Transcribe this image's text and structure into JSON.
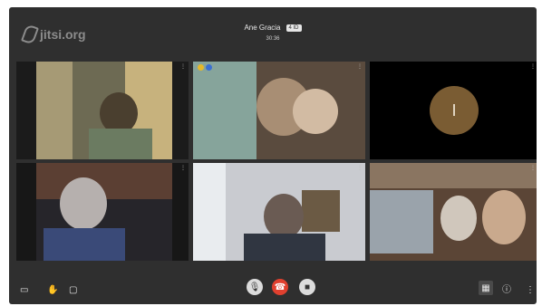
{
  "app": {
    "logo_text": "jitsi.org"
  },
  "header": {
    "participant_name": "Ane Gracia",
    "badge": "4 ID",
    "timer": "30:36"
  },
  "tiles": [
    {
      "id": "tile-1",
      "kind": "video",
      "corner": "⋮"
    },
    {
      "id": "tile-2",
      "kind": "video",
      "active": true,
      "corner": "⋮"
    },
    {
      "id": "tile-3",
      "kind": "avatar",
      "initial": "I",
      "corner": "⋮"
    },
    {
      "id": "tile-4",
      "kind": "video",
      "corner": "⋮"
    },
    {
      "id": "tile-5",
      "kind": "video",
      "corner": "⋮"
    },
    {
      "id": "tile-6",
      "kind": "video",
      "corner": "⋮"
    }
  ],
  "toolbar": {
    "left": [
      {
        "name": "screen-share-icon",
        "glyph": "▭"
      },
      {
        "name": "raise-hand-icon",
        "glyph": "✋"
      },
      {
        "name": "chat-icon",
        "glyph": "▢"
      }
    ],
    "center": [
      {
        "name": "microphone-button",
        "glyph": "🎙"
      },
      {
        "name": "hangup-button",
        "glyph": "☎"
      },
      {
        "name": "camera-button",
        "glyph": "■"
      }
    ],
    "right": [
      {
        "name": "tile-view-button",
        "glyph": "▦"
      },
      {
        "name": "info-button",
        "glyph": "ⓘ"
      },
      {
        "name": "more-options-button",
        "glyph": "⋮"
      }
    ]
  },
  "colors": {
    "hangup": "#e0402f",
    "active_outline": "#3b6fd1",
    "avatar": "#7a5c33"
  }
}
